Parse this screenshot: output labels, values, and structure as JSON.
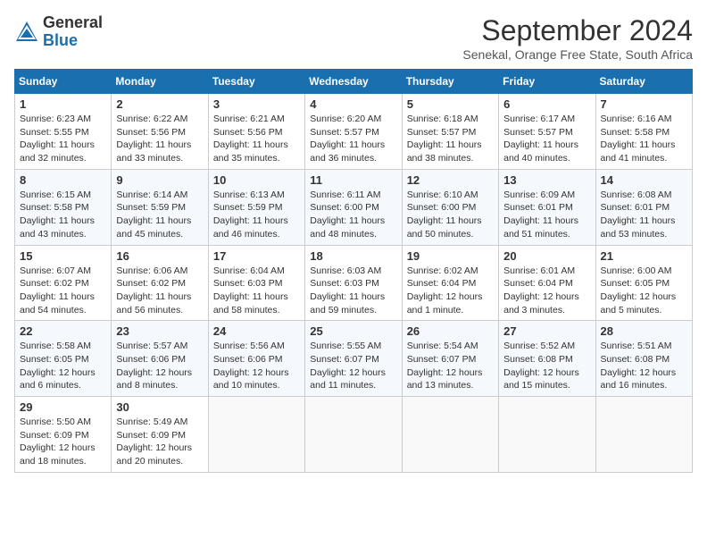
{
  "header": {
    "logo_general": "General",
    "logo_blue": "Blue",
    "month_title": "September 2024",
    "location": "Senekal, Orange Free State, South Africa"
  },
  "weekdays": [
    "Sunday",
    "Monday",
    "Tuesday",
    "Wednesday",
    "Thursday",
    "Friday",
    "Saturday"
  ],
  "weeks": [
    [
      {
        "day": "1",
        "sunrise": "6:23 AM",
        "sunset": "5:55 PM",
        "daylight": "11 hours and 32 minutes."
      },
      {
        "day": "2",
        "sunrise": "6:22 AM",
        "sunset": "5:56 PM",
        "daylight": "11 hours and 33 minutes."
      },
      {
        "day": "3",
        "sunrise": "6:21 AM",
        "sunset": "5:56 PM",
        "daylight": "11 hours and 35 minutes."
      },
      {
        "day": "4",
        "sunrise": "6:20 AM",
        "sunset": "5:57 PM",
        "daylight": "11 hours and 36 minutes."
      },
      {
        "day": "5",
        "sunrise": "6:18 AM",
        "sunset": "5:57 PM",
        "daylight": "11 hours and 38 minutes."
      },
      {
        "day": "6",
        "sunrise": "6:17 AM",
        "sunset": "5:57 PM",
        "daylight": "11 hours and 40 minutes."
      },
      {
        "day": "7",
        "sunrise": "6:16 AM",
        "sunset": "5:58 PM",
        "daylight": "11 hours and 41 minutes."
      }
    ],
    [
      {
        "day": "8",
        "sunrise": "6:15 AM",
        "sunset": "5:58 PM",
        "daylight": "11 hours and 43 minutes."
      },
      {
        "day": "9",
        "sunrise": "6:14 AM",
        "sunset": "5:59 PM",
        "daylight": "11 hours and 45 minutes."
      },
      {
        "day": "10",
        "sunrise": "6:13 AM",
        "sunset": "5:59 PM",
        "daylight": "11 hours and 46 minutes."
      },
      {
        "day": "11",
        "sunrise": "6:11 AM",
        "sunset": "6:00 PM",
        "daylight": "11 hours and 48 minutes."
      },
      {
        "day": "12",
        "sunrise": "6:10 AM",
        "sunset": "6:00 PM",
        "daylight": "11 hours and 50 minutes."
      },
      {
        "day": "13",
        "sunrise": "6:09 AM",
        "sunset": "6:01 PM",
        "daylight": "11 hours and 51 minutes."
      },
      {
        "day": "14",
        "sunrise": "6:08 AM",
        "sunset": "6:01 PM",
        "daylight": "11 hours and 53 minutes."
      }
    ],
    [
      {
        "day": "15",
        "sunrise": "6:07 AM",
        "sunset": "6:02 PM",
        "daylight": "11 hours and 54 minutes."
      },
      {
        "day": "16",
        "sunrise": "6:06 AM",
        "sunset": "6:02 PM",
        "daylight": "11 hours and 56 minutes."
      },
      {
        "day": "17",
        "sunrise": "6:04 AM",
        "sunset": "6:03 PM",
        "daylight": "11 hours and 58 minutes."
      },
      {
        "day": "18",
        "sunrise": "6:03 AM",
        "sunset": "6:03 PM",
        "daylight": "11 hours and 59 minutes."
      },
      {
        "day": "19",
        "sunrise": "6:02 AM",
        "sunset": "6:04 PM",
        "daylight": "12 hours and 1 minute."
      },
      {
        "day": "20",
        "sunrise": "6:01 AM",
        "sunset": "6:04 PM",
        "daylight": "12 hours and 3 minutes."
      },
      {
        "day": "21",
        "sunrise": "6:00 AM",
        "sunset": "6:05 PM",
        "daylight": "12 hours and 5 minutes."
      }
    ],
    [
      {
        "day": "22",
        "sunrise": "5:58 AM",
        "sunset": "6:05 PM",
        "daylight": "12 hours and 6 minutes."
      },
      {
        "day": "23",
        "sunrise": "5:57 AM",
        "sunset": "6:06 PM",
        "daylight": "12 hours and 8 minutes."
      },
      {
        "day": "24",
        "sunrise": "5:56 AM",
        "sunset": "6:06 PM",
        "daylight": "12 hours and 10 minutes."
      },
      {
        "day": "25",
        "sunrise": "5:55 AM",
        "sunset": "6:07 PM",
        "daylight": "12 hours and 11 minutes."
      },
      {
        "day": "26",
        "sunrise": "5:54 AM",
        "sunset": "6:07 PM",
        "daylight": "12 hours and 13 minutes."
      },
      {
        "day": "27",
        "sunrise": "5:52 AM",
        "sunset": "6:08 PM",
        "daylight": "12 hours and 15 minutes."
      },
      {
        "day": "28",
        "sunrise": "5:51 AM",
        "sunset": "6:08 PM",
        "daylight": "12 hours and 16 minutes."
      }
    ],
    [
      {
        "day": "29",
        "sunrise": "5:50 AM",
        "sunset": "6:09 PM",
        "daylight": "12 hours and 18 minutes."
      },
      {
        "day": "30",
        "sunrise": "5:49 AM",
        "sunset": "6:09 PM",
        "daylight": "12 hours and 20 minutes."
      },
      null,
      null,
      null,
      null,
      null
    ]
  ]
}
